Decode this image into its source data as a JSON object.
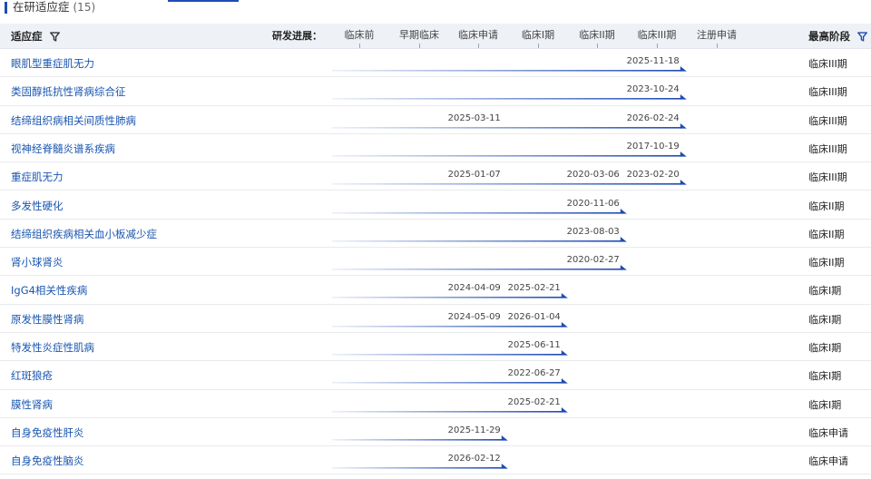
{
  "section": {
    "title": "在研适应症",
    "count": "(15)"
  },
  "header": {
    "indication_label": "适应症",
    "progress_label": "研发进展：",
    "highest_label": "最高阶段"
  },
  "stages": [
    "临床前",
    "早期临床",
    "临床申请",
    "临床I期",
    "临床II期",
    "临床III期",
    "注册申请"
  ],
  "colors": {
    "accent": "#1f4bb3",
    "link": "#1a56b0",
    "header_bg": "#eef1f6"
  },
  "rows": [
    {
      "name": "眼肌型重症肌无力",
      "highest": "临床III期",
      "level": 5,
      "dates": [
        {
          "stage": 5,
          "text": "2025-11-18"
        }
      ]
    },
    {
      "name": "类固醇抵抗性肾病综合征",
      "highest": "临床III期",
      "level": 5,
      "dates": [
        {
          "stage": 5,
          "text": "2023-10-24"
        }
      ]
    },
    {
      "name": "结缔组织病相关间质性肺病",
      "highest": "临床III期",
      "level": 5,
      "dates": [
        {
          "stage": 2,
          "text": "2025-03-11"
        },
        {
          "stage": 5,
          "text": "2026-02-24"
        }
      ]
    },
    {
      "name": "视神经脊髓炎谱系疾病",
      "highest": "临床III期",
      "level": 5,
      "dates": [
        {
          "stage": 5,
          "text": "2017-10-19"
        }
      ]
    },
    {
      "name": "重症肌无力",
      "highest": "临床III期",
      "level": 5,
      "dates": [
        {
          "stage": 2,
          "text": "2025-01-07"
        },
        {
          "stage": 4,
          "text": "2020-03-06"
        },
        {
          "stage": 5,
          "text": "2023-02-20"
        }
      ]
    },
    {
      "name": "多发性硬化",
      "highest": "临床II期",
      "level": 4,
      "dates": [
        {
          "stage": 4,
          "text": "2020-11-06"
        }
      ]
    },
    {
      "name": "结缔组织疾病相关血小板减少症",
      "highest": "临床II期",
      "level": 4,
      "dates": [
        {
          "stage": 4,
          "text": "2023-08-03"
        }
      ]
    },
    {
      "name": "肾小球肾炎",
      "highest": "临床II期",
      "level": 4,
      "dates": [
        {
          "stage": 4,
          "text": "2020-02-27"
        }
      ]
    },
    {
      "name": "IgG4相关性疾病",
      "highest": "临床I期",
      "level": 3,
      "dates": [
        {
          "stage": 2,
          "text": "2024-04-09"
        },
        {
          "stage": 3,
          "text": "2025-02-21"
        }
      ]
    },
    {
      "name": "原发性膜性肾病",
      "highest": "临床I期",
      "level": 3,
      "dates": [
        {
          "stage": 2,
          "text": "2024-05-09"
        },
        {
          "stage": 3,
          "text": "2026-01-04"
        }
      ]
    },
    {
      "name": "特发性炎症性肌病",
      "highest": "临床I期",
      "level": 3,
      "dates": [
        {
          "stage": 3,
          "text": "2025-06-11"
        }
      ]
    },
    {
      "name": "红斑狼疮",
      "highest": "临床I期",
      "level": 3,
      "dates": [
        {
          "stage": 3,
          "text": "2022-06-27"
        }
      ]
    },
    {
      "name": "膜性肾病",
      "highest": "临床I期",
      "level": 3,
      "dates": [
        {
          "stage": 3,
          "text": "2025-02-21"
        }
      ]
    },
    {
      "name": "自身免疫性肝炎",
      "highest": "临床申请",
      "level": 2,
      "dates": [
        {
          "stage": 2,
          "text": "2025-11-29"
        }
      ]
    },
    {
      "name": "自身免疫性脑炎",
      "highest": "临床申请",
      "level": 2,
      "dates": [
        {
          "stage": 2,
          "text": "2026-02-12"
        }
      ]
    }
  ]
}
